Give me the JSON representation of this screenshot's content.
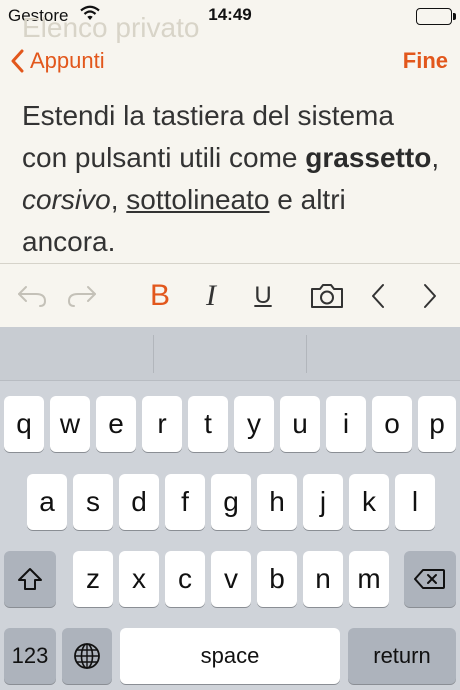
{
  "status_bar": {
    "carrier": "Gestore",
    "time": "14:49"
  },
  "nav": {
    "ghost_title": "Elenco privato",
    "back_label": "Appunti",
    "done_label": "Fine"
  },
  "note": {
    "p1": "Estendi la tastiera del sistema con pulsanti utili come ",
    "bold": "grassetto",
    "p2": ", ",
    "italic": "corsivo",
    "p3": ", ",
    "underline": "sottolineato",
    "p4": " e altri ancora."
  },
  "toolbar": {
    "bold_label": "B",
    "italic_label": "I",
    "underline_label": "U"
  },
  "keyboard": {
    "row1": [
      "q",
      "w",
      "e",
      "r",
      "t",
      "y",
      "u",
      "i",
      "o",
      "p"
    ],
    "row2": [
      "a",
      "s",
      "d",
      "f",
      "g",
      "h",
      "j",
      "k",
      "l"
    ],
    "row3": [
      "z",
      "x",
      "c",
      "v",
      "b",
      "n",
      "m"
    ],
    "numbers_label": "123",
    "space_label": "space",
    "return_label": "return"
  },
  "colors": {
    "accent": "#e2571c",
    "background": "#f7f5ef",
    "keyboard_bg": "#cfd3d9"
  }
}
